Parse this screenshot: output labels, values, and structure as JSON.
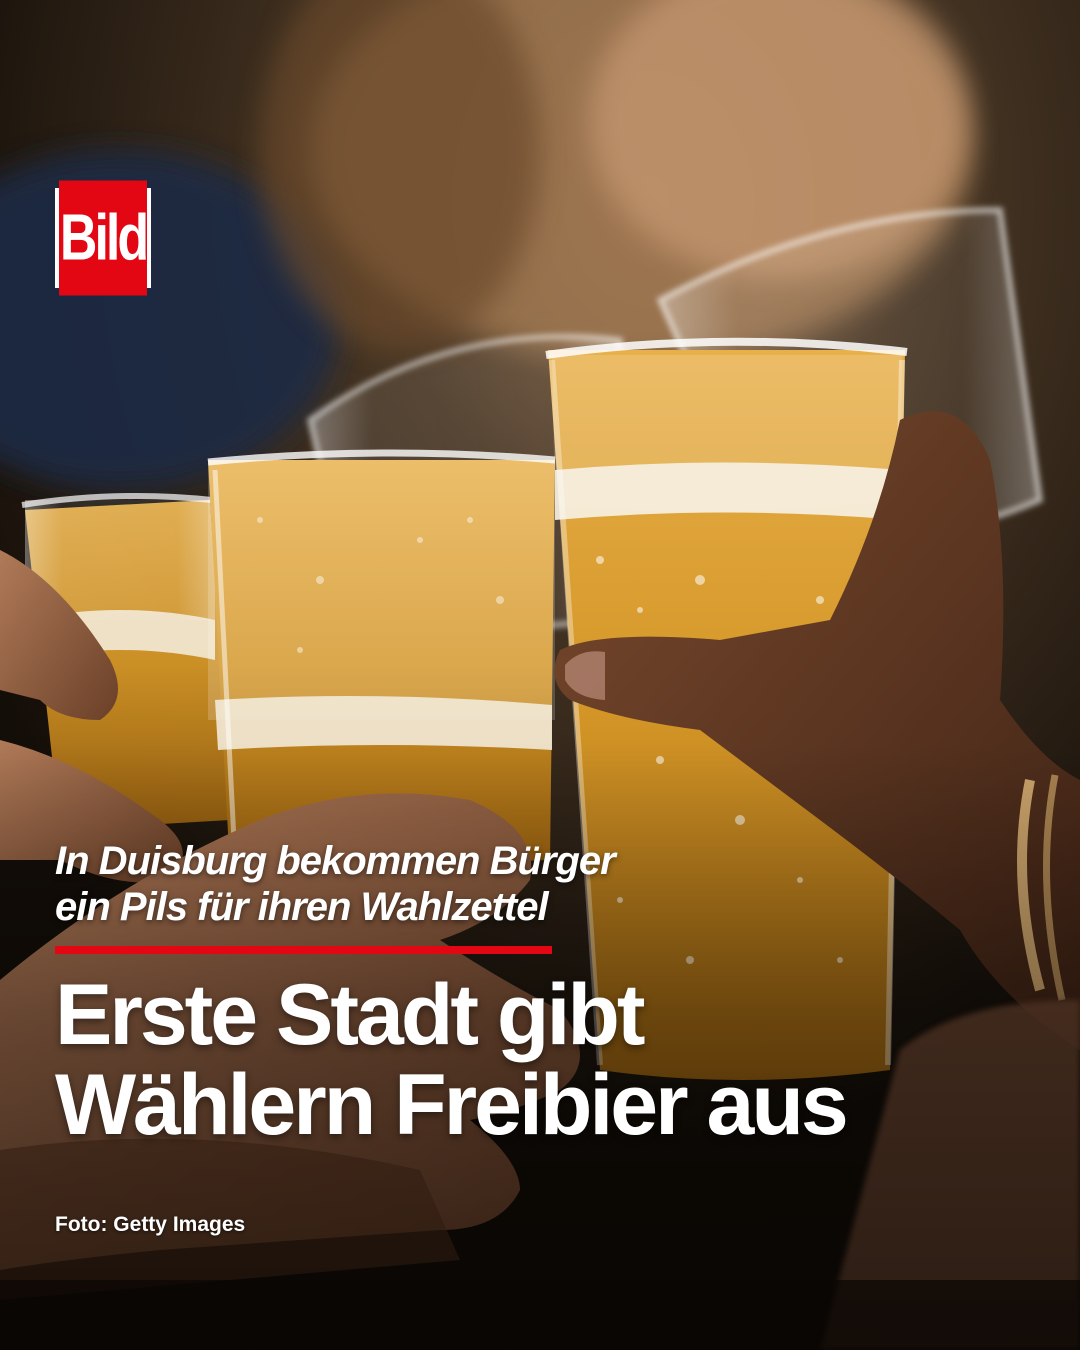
{
  "brand": {
    "logo_text": "Bild",
    "red": "#e30613"
  },
  "photo": {
    "subject_icon": "beer-glasses-toast-photo"
  },
  "kicker": {
    "line1": "In Duisburg bekommen Bürger",
    "line2": "ein Pils für ihren Wahlzettel"
  },
  "headline": {
    "line1": "Erste Stadt gibt",
    "line2": "Wählern Freibier aus"
  },
  "credit": "Foto: Getty Images"
}
